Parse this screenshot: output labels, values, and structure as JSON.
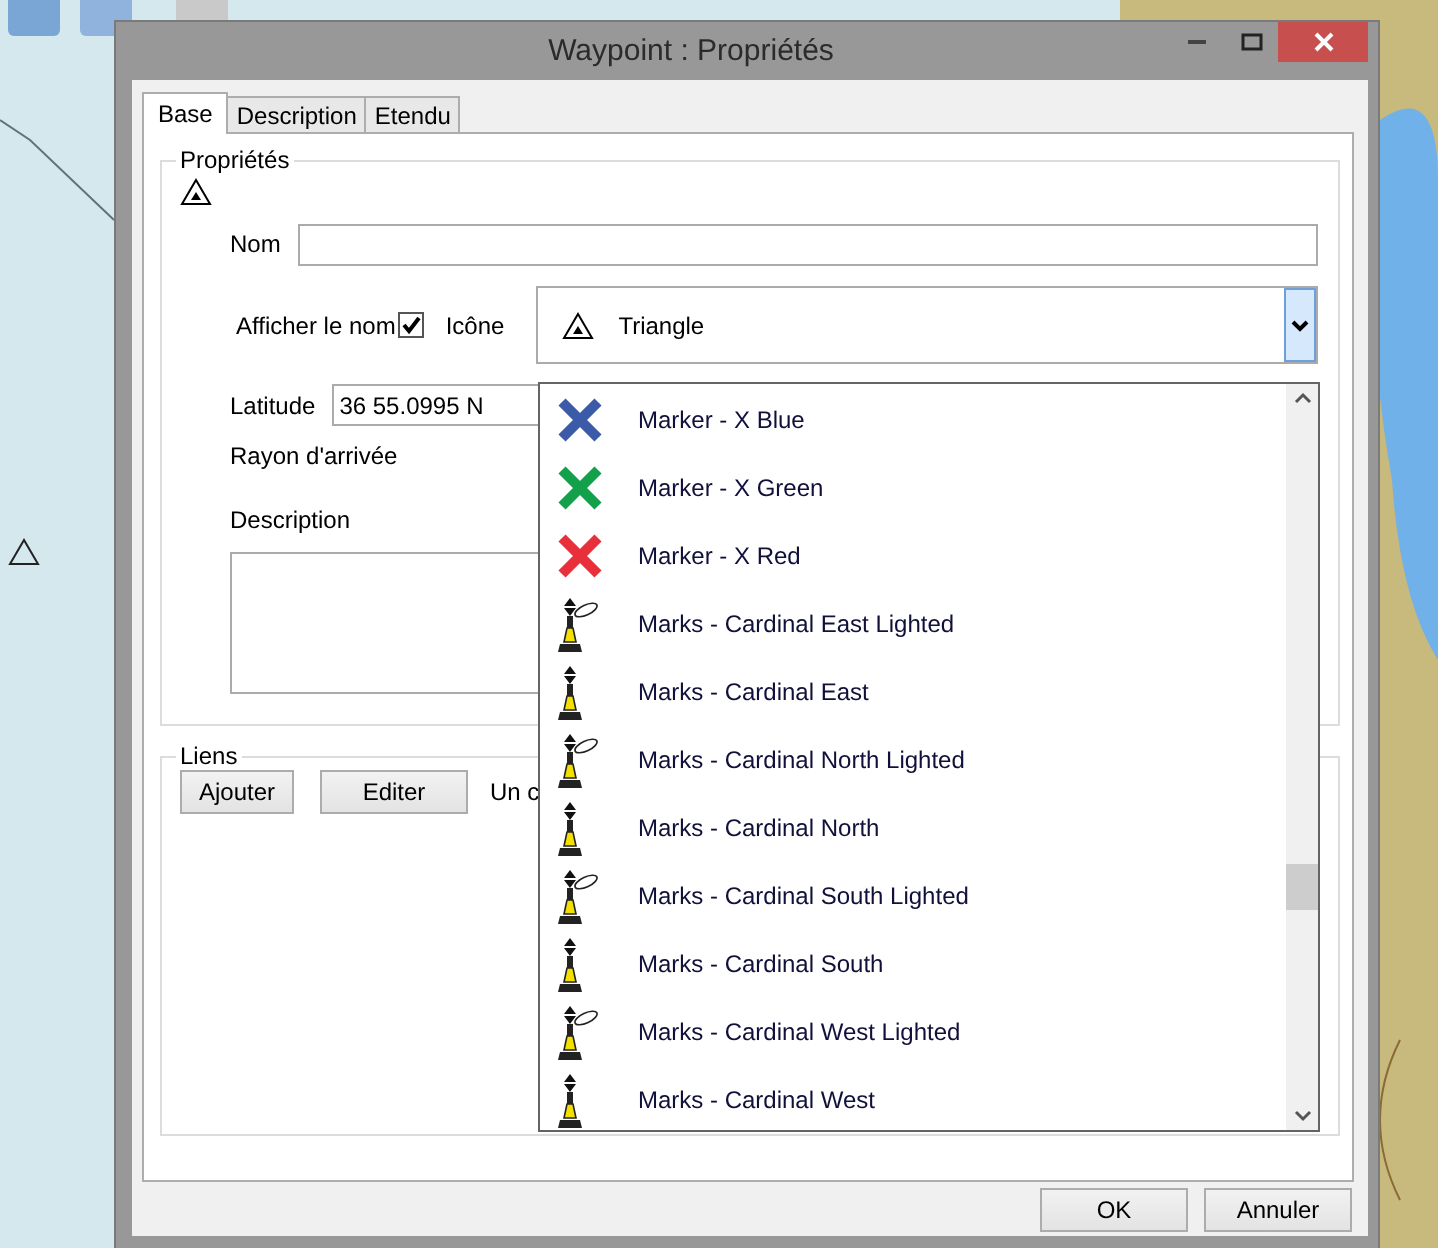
{
  "window": {
    "title": "Waypoint : Propriétés"
  },
  "tabs": [
    {
      "label": "Base",
      "selected": true
    },
    {
      "label": "Description",
      "selected": false
    },
    {
      "label": "Etendu",
      "selected": false
    }
  ],
  "properties": {
    "title": "Propriétés",
    "name_label": "Nom",
    "show_name": {
      "label": "Afficher le nom",
      "checked": true
    },
    "icon_label": "Icône",
    "icon_value": "Triangle",
    "latitude_label": "Latitude",
    "latitude_value": "36 55.0995 N",
    "radius_label": "Rayon d'arrivée",
    "description_label": "Description"
  },
  "icon_list": [
    {
      "label": "Marker - X Blue",
      "kind": "cross",
      "color": "#3b5ba8"
    },
    {
      "label": "Marker - X Green",
      "kind": "cross",
      "color": "#12a04a"
    },
    {
      "label": "Marker - X Red",
      "kind": "cross",
      "color": "#e8303a"
    },
    {
      "label": "Marks - Cardinal East Lighted",
      "kind": "lit-buoy"
    },
    {
      "label": "Marks - Cardinal East",
      "kind": "buoy"
    },
    {
      "label": "Marks - Cardinal North Lighted",
      "kind": "lit-buoy"
    },
    {
      "label": "Marks - Cardinal North",
      "kind": "buoy"
    },
    {
      "label": "Marks - Cardinal South Lighted",
      "kind": "lit-buoy"
    },
    {
      "label": "Marks - Cardinal South",
      "kind": "buoy"
    },
    {
      "label": "Marks - Cardinal West Lighted",
      "kind": "lit-buoy"
    },
    {
      "label": "Marks - Cardinal West",
      "kind": "buoy"
    }
  ],
  "links": {
    "title": "Liens",
    "buttons": [
      "Ajouter",
      "Editer"
    ],
    "note": "Un c"
  },
  "buttons": [
    "OK",
    "Annuler"
  ]
}
